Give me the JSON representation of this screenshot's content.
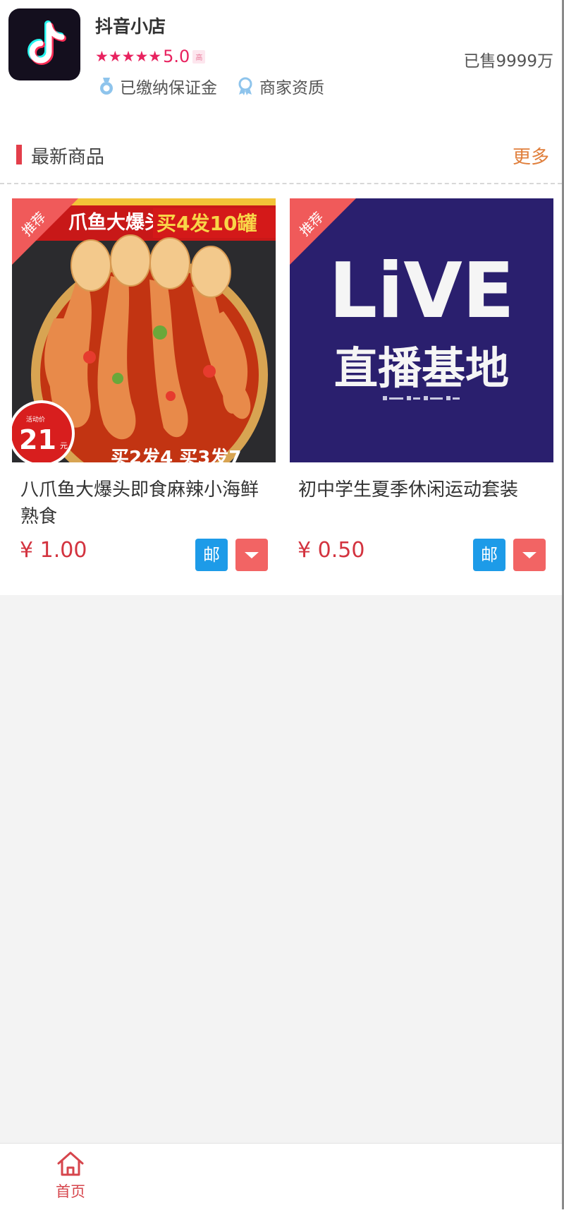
{
  "shop": {
    "name": "抖音小店",
    "stars": "★★★★★",
    "score": "5.0",
    "score_suffix": "高",
    "sold": "已售9999万",
    "badges": [
      {
        "label": "已缴纳保证金",
        "icon": "deposit-medal-icon"
      },
      {
        "label": "商家资质",
        "icon": "merchant-certificate-icon"
      }
    ],
    "logo_icon": "tiktok-logo"
  },
  "section": {
    "title": "最新商品",
    "more": "更多"
  },
  "products": [
    {
      "title": "八爪鱼大爆头即食麻辣小海鲜熟食",
      "price": "¥ 1.00",
      "tag": "推荐",
      "mail_label": "邮",
      "image": {
        "banner_left": "爪鱼大爆头",
        "banner_right": "买4发10罐",
        "badge_small": "活动价",
        "badge_number": "21",
        "badge_unit": "元",
        "bottom_text": "买2发4 买3发7"
      }
    },
    {
      "title": "初中学生夏季休闲运动套装",
      "price": "¥ 0.50",
      "tag": "推荐",
      "mail_label": "邮",
      "image": {
        "line1": "LiVE",
        "line2": "直播基地"
      }
    }
  ],
  "tabbar": {
    "home_label": "首页",
    "home_icon": "home-icon"
  },
  "colors": {
    "accent_red": "#e33e4a",
    "price_red": "#d3333f",
    "more_orange": "#e07f3c",
    "mail_blue": "#1d9be8",
    "cart_red": "#f26464",
    "star_pink": "#e8225f",
    "live_bg": "#2a1f6e"
  }
}
